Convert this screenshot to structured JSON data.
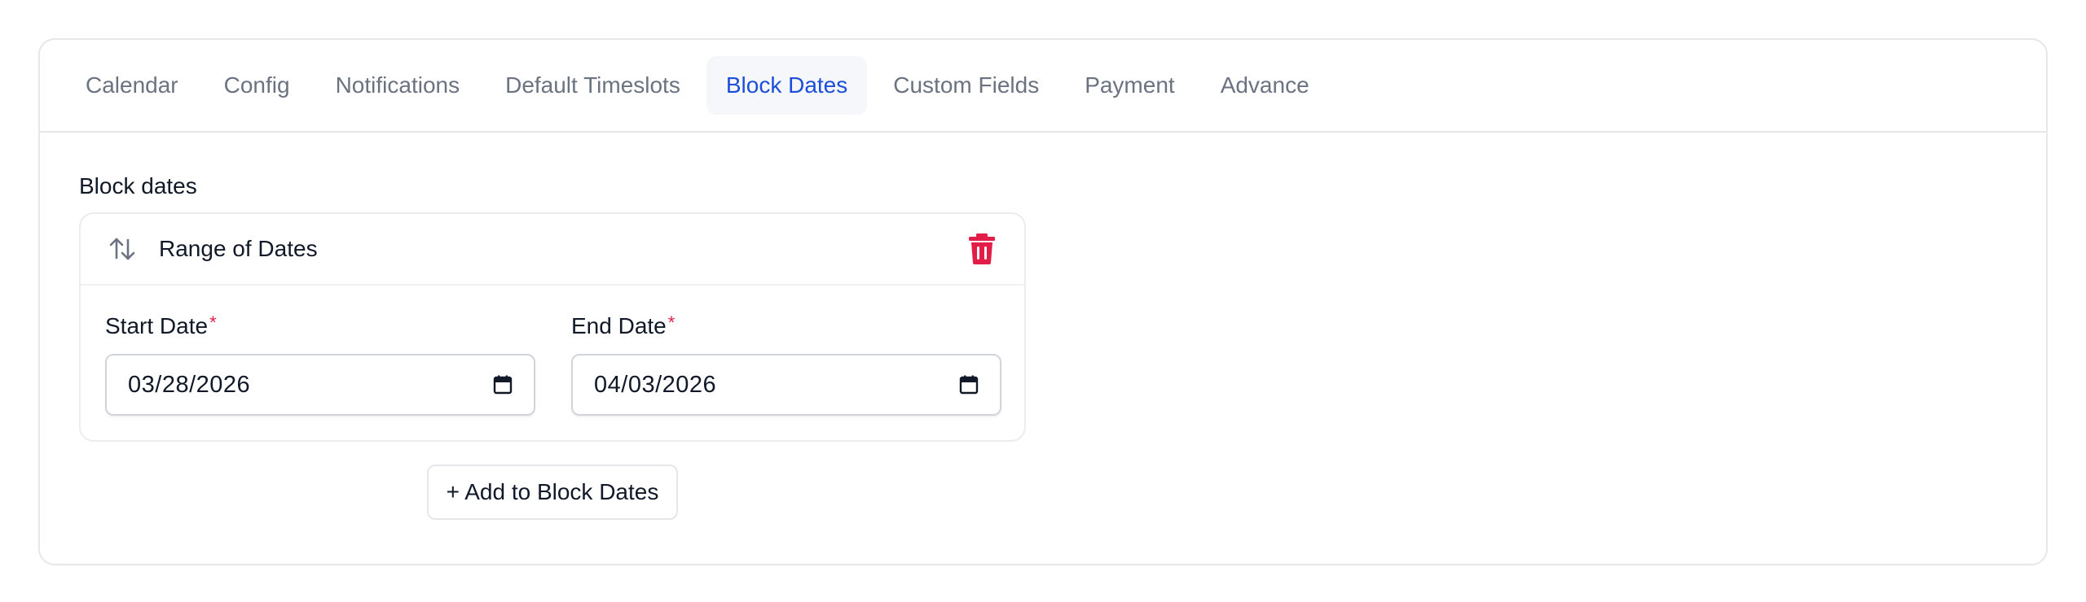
{
  "tabs": [
    {
      "label": "Calendar",
      "active": false
    },
    {
      "label": "Config",
      "active": false
    },
    {
      "label": "Notifications",
      "active": false
    },
    {
      "label": "Default Timeslots",
      "active": false
    },
    {
      "label": "Block Dates",
      "active": true
    },
    {
      "label": "Custom Fields",
      "active": false
    },
    {
      "label": "Payment",
      "active": false
    },
    {
      "label": "Advance",
      "active": false
    }
  ],
  "section": {
    "label": "Block dates"
  },
  "block": {
    "sort_icon": "sort-arrows-icon",
    "title": "Range of Dates",
    "delete_icon": "trash-icon",
    "start": {
      "label": "Start Date",
      "required_mark": "*",
      "value": "03/28/2026",
      "icon": "calendar-icon"
    },
    "end": {
      "label": "End Date",
      "required_mark": "*",
      "value": "04/03/2026",
      "icon": "calendar-icon"
    }
  },
  "add_button": {
    "label": "+ Add to Block Dates"
  },
  "colors": {
    "accent": "#1d4ed8",
    "danger": "#e11d48",
    "tab_text": "#6b7280",
    "border": "#e5e7eb"
  }
}
